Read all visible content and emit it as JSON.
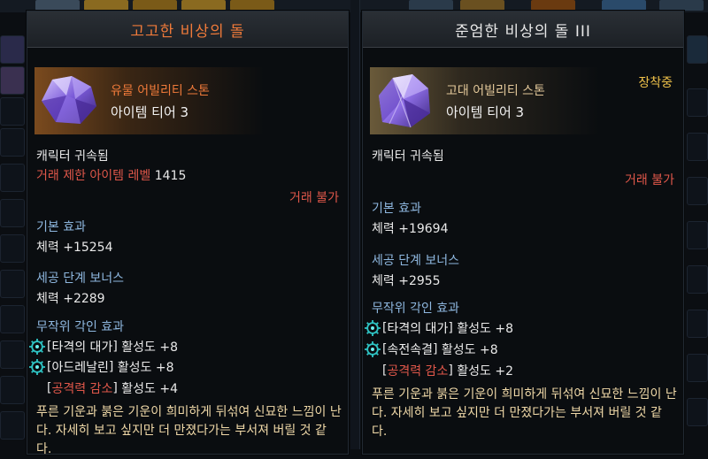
{
  "left": {
    "title": "고고한 비상의 돌",
    "grade": "유물 어빌리티 스톤",
    "tier": "아이템 티어 3",
    "bound": "캐릭터 귀속됨",
    "trade_limit_label": "거래 제한 아이템 레벨",
    "trade_limit_value": "1415",
    "trade": "거래 불가",
    "base_header": "기본 효과",
    "base_stat": "체력 +15254",
    "bonus_header": "세공 단계 보너스",
    "bonus_stat": "체력 +2289",
    "engrave_header": "무작위 각인 효과",
    "engravings": [
      {
        "name": "타격의 대가",
        "value": "활성도 +8",
        "negative": false
      },
      {
        "name": "아드레날린",
        "value": "활성도 +8",
        "negative": false
      },
      {
        "name": "공격력 감소",
        "value": "활성도 +4",
        "negative": true
      }
    ],
    "flavor": "푸른 기운과 붉은 기운이 희미하게 뒤섞여 신묘한 느낌이 난다. 자세히 보고 싶지만 더 만졌다가는 부서져 버릴 것 같다."
  },
  "right": {
    "title": "준엄한 비상의 돌 III",
    "grade": "고대 어빌리티 스톤",
    "tier": "아이템 티어 3",
    "equipped": "장착중",
    "bound": "캐릭터 귀속됨",
    "trade": "거래 불가",
    "base_header": "기본 효과",
    "base_stat": "체력 +19694",
    "bonus_header": "세공 단계 보너스",
    "bonus_stat": "체력 +2955",
    "engrave_header": "무작위 각인 효과",
    "engravings": [
      {
        "name": "타격의 대가",
        "value": "활성도 +8",
        "negative": false
      },
      {
        "name": "속전속결",
        "value": "활성도 +8",
        "negative": false
      },
      {
        "name": "공격력 감소",
        "value": "활성도 +2",
        "negative": true
      }
    ],
    "flavor": "푸른 기운과 붉은 기운이 희미하게 뒤섞여 신묘한 느낌이 난다. 자세히 보고 싶지만 더 만졌다가는 부서져 버릴 것 같다."
  },
  "colors": {
    "relic_orange": "#ef7a3a",
    "ancient_tan": "#e3c89a",
    "negative_red": "#e0574a",
    "section_blue": "#8fb8e0",
    "flavor_yellow": "#f0d9a8",
    "equipped_gold": "#f0c24a"
  },
  "icons": [
    "ability-stone-icon",
    "engraving-gear-icon"
  ]
}
